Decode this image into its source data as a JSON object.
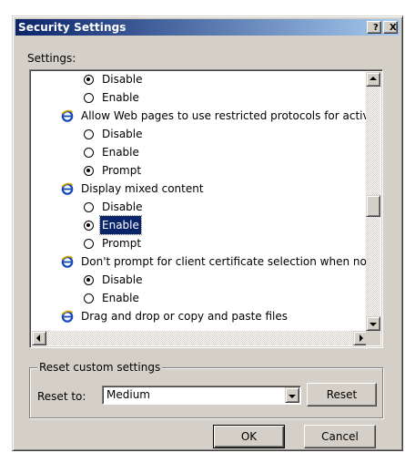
{
  "window": {
    "title": "Security Settings",
    "help_label": "?",
    "close_label": "X"
  },
  "settings_label": "Settings:",
  "tree": {
    "rows": [
      {
        "kind": "option",
        "label": "Disable",
        "checked": true
      },
      {
        "kind": "option",
        "label": "Enable",
        "checked": false
      },
      {
        "kind": "heading",
        "label": "Allow Web pages to use restricted protocols for active"
      },
      {
        "kind": "option",
        "label": "Disable",
        "checked": false
      },
      {
        "kind": "option",
        "label": "Enable",
        "checked": false
      },
      {
        "kind": "option",
        "label": "Prompt",
        "checked": true
      },
      {
        "kind": "heading",
        "label": "Display mixed content"
      },
      {
        "kind": "option",
        "label": "Disable",
        "checked": false
      },
      {
        "kind": "option",
        "label": "Enable",
        "checked": true,
        "selected": true
      },
      {
        "kind": "option",
        "label": "Prompt",
        "checked": false
      },
      {
        "kind": "heading",
        "label": "Don't prompt for client certificate selection when no cer"
      },
      {
        "kind": "option",
        "label": "Disable",
        "checked": true
      },
      {
        "kind": "option",
        "label": "Enable",
        "checked": false
      },
      {
        "kind": "heading",
        "label": "Drag and drop or copy and paste files"
      }
    ],
    "scroll_position": 0.52
  },
  "reset_group": {
    "title": "Reset custom settings",
    "reset_to_label": "Reset to:",
    "selected_level": "Medium",
    "reset_button": "Reset"
  },
  "buttons": {
    "ok": "OK",
    "cancel": "Cancel"
  }
}
